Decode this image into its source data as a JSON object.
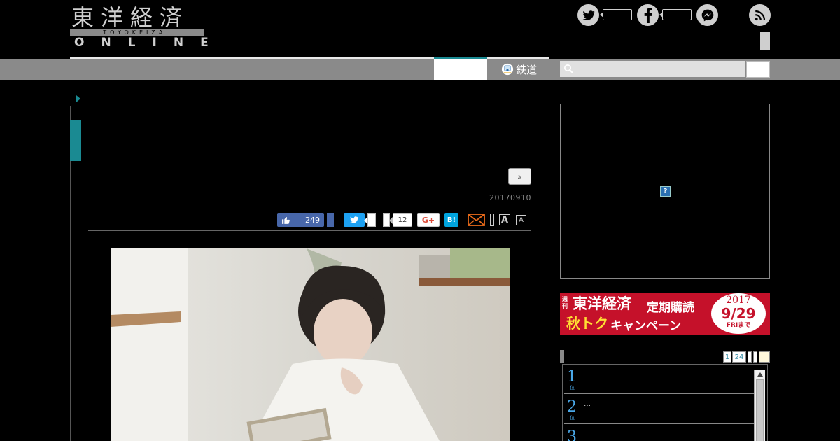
{
  "logo": {
    "title": "東洋経済",
    "subtitle": "TOYOKEIZAI",
    "online": "ONLINE"
  },
  "icons": {
    "twitter": "twitter-icon",
    "facebook": "facebook-icon",
    "messenger": "messenger-icon",
    "rss": "rss-icon",
    "search": "search-icon",
    "mail": "mail-icon",
    "like": "thumbs-up-icon"
  },
  "nav": {
    "railway_label": "鉄道"
  },
  "search": {
    "value": ""
  },
  "article": {
    "next_label": "»",
    "date": "20170910"
  },
  "share": {
    "fb_count": "249",
    "count_12": "12",
    "gplus_label": "G+",
    "hatena_label": "B!",
    "font_large": "A",
    "font_small": "A"
  },
  "ad": {
    "question_label": "?"
  },
  "banner": {
    "weekly": "週刊",
    "title": "東洋経済",
    "subscription": "定期購読",
    "campaign_a": "秋トク",
    "campaign_b": "キャンペーン",
    "year": "2017",
    "date": "9/29",
    "until": "FRIまで"
  },
  "ranking": {
    "tab_1": "1",
    "tab_24": "24",
    "items": [
      {
        "rank": "1",
        "unit": "位",
        "text": ""
      },
      {
        "rank": "2",
        "unit": "位",
        "text": "…"
      },
      {
        "rank": "3",
        "unit": "位",
        "text": ""
      }
    ]
  },
  "colors": {
    "accent": "#1a8a92",
    "facebook": "#4867aa",
    "twitter": "#1da1f2",
    "hatena": "#00a4de",
    "banner_red": "#c5112a"
  }
}
